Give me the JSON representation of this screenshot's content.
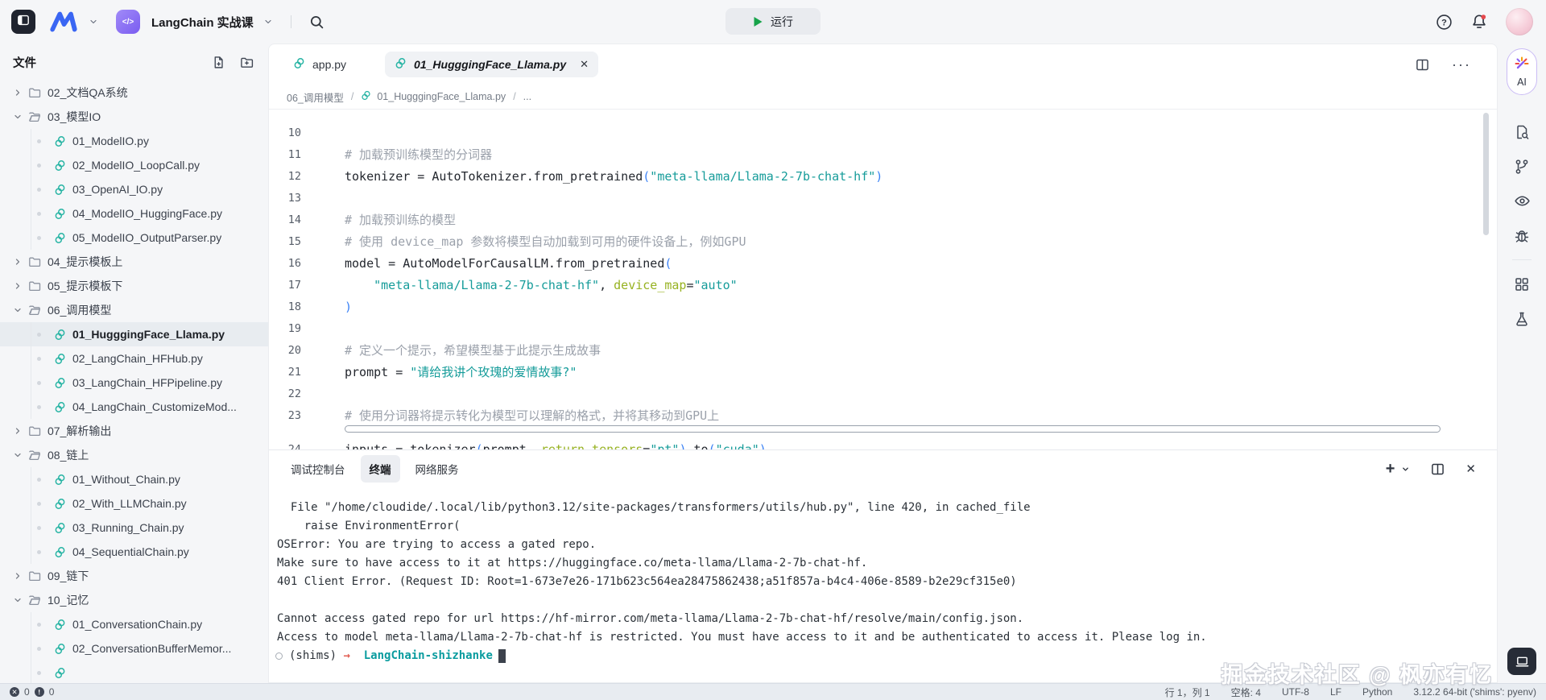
{
  "colors": {
    "logo_blue": "#3a66f3",
    "badge_purple": "#8d77f3",
    "python_teal": "#2ab5a5",
    "run_green": "#17a34a",
    "string": "#169c9a",
    "comment": "#9ba1ab",
    "param": "#97b221",
    "paren": "#3b82f6",
    "prompt": "#0a9c9f",
    "arrow": "#e25d52",
    "bell_badge_red": "#e5484d"
  },
  "topbar": {
    "project_badge": "</>",
    "project_title": "LangChain 实战课",
    "run_label": "运行"
  },
  "sidebar": {
    "title": "文件",
    "tree": [
      {
        "type": "folder",
        "state": "collapsed",
        "label": "02_文档QA系统"
      },
      {
        "type": "folder",
        "state": "expanded",
        "label": "03_模型IO"
      },
      {
        "type": "file",
        "label": "01_ModelIO.py"
      },
      {
        "type": "file",
        "label": "02_ModelIO_LoopCall.py"
      },
      {
        "type": "file",
        "label": "03_OpenAI_IO.py"
      },
      {
        "type": "file",
        "label": "04_ModelIO_HuggingFace.py"
      },
      {
        "type": "file",
        "label": "05_ModelIO_OutputParser.py"
      },
      {
        "type": "folder",
        "state": "collapsed",
        "label": "04_提示模板上"
      },
      {
        "type": "folder",
        "state": "collapsed",
        "label": "05_提示模板下"
      },
      {
        "type": "folder",
        "state": "expanded",
        "label": "06_调用模型"
      },
      {
        "type": "file",
        "label": "01_HugggingFace_Llama.py",
        "selected": true
      },
      {
        "type": "file",
        "label": "02_LangChain_HFHub.py"
      },
      {
        "type": "file",
        "label": "03_LangChain_HFPipeline.py"
      },
      {
        "type": "file",
        "label": "04_LangChain_CustomizeMod..."
      },
      {
        "type": "folder",
        "state": "collapsed",
        "label": "07_解析输出"
      },
      {
        "type": "folder",
        "state": "expanded",
        "label": "08_链上"
      },
      {
        "type": "file",
        "label": "01_Without_Chain.py"
      },
      {
        "type": "file",
        "label": "02_With_LLMChain.py"
      },
      {
        "type": "file",
        "label": "03_Running_Chain.py"
      },
      {
        "type": "file",
        "label": "04_SequentialChain.py"
      },
      {
        "type": "folder",
        "state": "collapsed",
        "label": "09_链下"
      },
      {
        "type": "folder",
        "state": "expanded",
        "label": "10_记忆"
      },
      {
        "type": "file",
        "label": "01_ConversationChain.py"
      },
      {
        "type": "file",
        "label": "02_ConversationBufferMemor..."
      },
      {
        "type": "file",
        "label": ""
      }
    ]
  },
  "editor": {
    "tabs": [
      {
        "label": "app.py",
        "active": false
      },
      {
        "label": "01_HugggingFace_Llama.py",
        "active": true
      }
    ],
    "breadcrumb": {
      "folder": "06_调用模型",
      "sep": "/",
      "file": "01_HugggingFace_Llama.py",
      "more": "..."
    },
    "code_lines": [
      {
        "n": "10",
        "seg": []
      },
      {
        "n": "11",
        "seg": [
          [
            "c",
            "# 加载预训练模型的分词器"
          ]
        ]
      },
      {
        "n": "12",
        "seg": [
          [
            "d",
            "tokenizer = AutoTokenizer.from_pretrained"
          ],
          [
            "p",
            "("
          ],
          [
            "s",
            "\"meta-llama/Llama-2-7b-chat-hf\""
          ],
          [
            "p",
            ")"
          ]
        ]
      },
      {
        "n": "13",
        "seg": []
      },
      {
        "n": "14",
        "seg": [
          [
            "c",
            "# 加载预训练的模型"
          ]
        ]
      },
      {
        "n": "15",
        "seg": [
          [
            "c",
            "# 使用 device_map 参数将模型自动加载到可用的硬件设备上，例如GPU"
          ]
        ]
      },
      {
        "n": "16",
        "seg": [
          [
            "d",
            "model = AutoModelForCausalLM.from_pretrained"
          ],
          [
            "p",
            "("
          ]
        ]
      },
      {
        "n": "17",
        "seg": [
          [
            "d",
            "    "
          ],
          [
            "s",
            "\"meta-llama/Llama-2-7b-chat-hf\""
          ],
          [
            "d",
            ", "
          ],
          [
            "g",
            "device_map"
          ],
          [
            "d",
            "="
          ],
          [
            "s",
            "\"auto\""
          ]
        ]
      },
      {
        "n": "18",
        "seg": [
          [
            "p",
            ")"
          ]
        ]
      },
      {
        "n": "19",
        "seg": []
      },
      {
        "n": "20",
        "seg": [
          [
            "c",
            "# 定义一个提示，希望模型基于此提示生成故事"
          ]
        ]
      },
      {
        "n": "21",
        "seg": [
          [
            "d",
            "prompt = "
          ],
          [
            "s",
            "\"请给我讲个玫瑰的爱情故事?\""
          ]
        ]
      },
      {
        "n": "22",
        "seg": []
      },
      {
        "n": "23",
        "seg": [
          [
            "c",
            "# 使用分词器将提示转化为模型可以理解的格式，并将其移动到GPU上"
          ]
        ]
      }
    ],
    "partial_line": {
      "n": "24",
      "seg": [
        [
          "d",
          "inputs = tokenizer"
        ],
        [
          "p",
          "("
        ],
        [
          "d",
          "prompt, "
        ],
        [
          "g",
          "return_tensors"
        ],
        [
          "d",
          "="
        ],
        [
          "s",
          "\"pt\""
        ],
        [
          "p",
          ")"
        ],
        [
          "d",
          ".to"
        ],
        [
          "p",
          "("
        ],
        [
          "s",
          "\"cuda\""
        ],
        [
          "p",
          ")"
        ]
      ]
    }
  },
  "panel": {
    "tabs": [
      {
        "label": "调试控制台",
        "active": false
      },
      {
        "label": "终端",
        "active": true
      },
      {
        "label": "网络服务",
        "active": false
      }
    ],
    "terminal_lines": [
      "  File \"/home/cloudide/.local/lib/python3.12/site-packages/transformers/utils/hub.py\", line 420, in cached_file",
      "    raise EnvironmentError(",
      "OSError: You are trying to access a gated repo.",
      "Make sure to have access to it at https://huggingface.co/meta-llama/Llama-2-7b-chat-hf.",
      "401 Client Error. (Request ID: Root=1-673e7e26-171b623c564ea28475862438;a51f857a-b4c4-406e-8589-b2e29cf315e0)",
      "",
      "Cannot access gated repo for url https://hf-mirror.com/meta-llama/Llama-2-7b-chat-hf/resolve/main/config.json.",
      "Access to model meta-llama/Llama-2-7b-chat-hf is restricted. You must have access to it and be authenticated to access it. Please log in."
    ],
    "prompt": {
      "env": "(shims)",
      "arrow": "→",
      "name": "LangChain-shizhanke"
    }
  },
  "right_rail": {
    "ai_label": "AI"
  },
  "statusbar": {
    "errors": "0",
    "warnings": "0",
    "items": [
      "行 1，列 1",
      "空格: 4",
      "UTF-8",
      "LF",
      "Python",
      "3.12.2 64-bit ('shims': pyenv)"
    ]
  },
  "watermark": "掘金技术社区 @ 枫亦有忆"
}
